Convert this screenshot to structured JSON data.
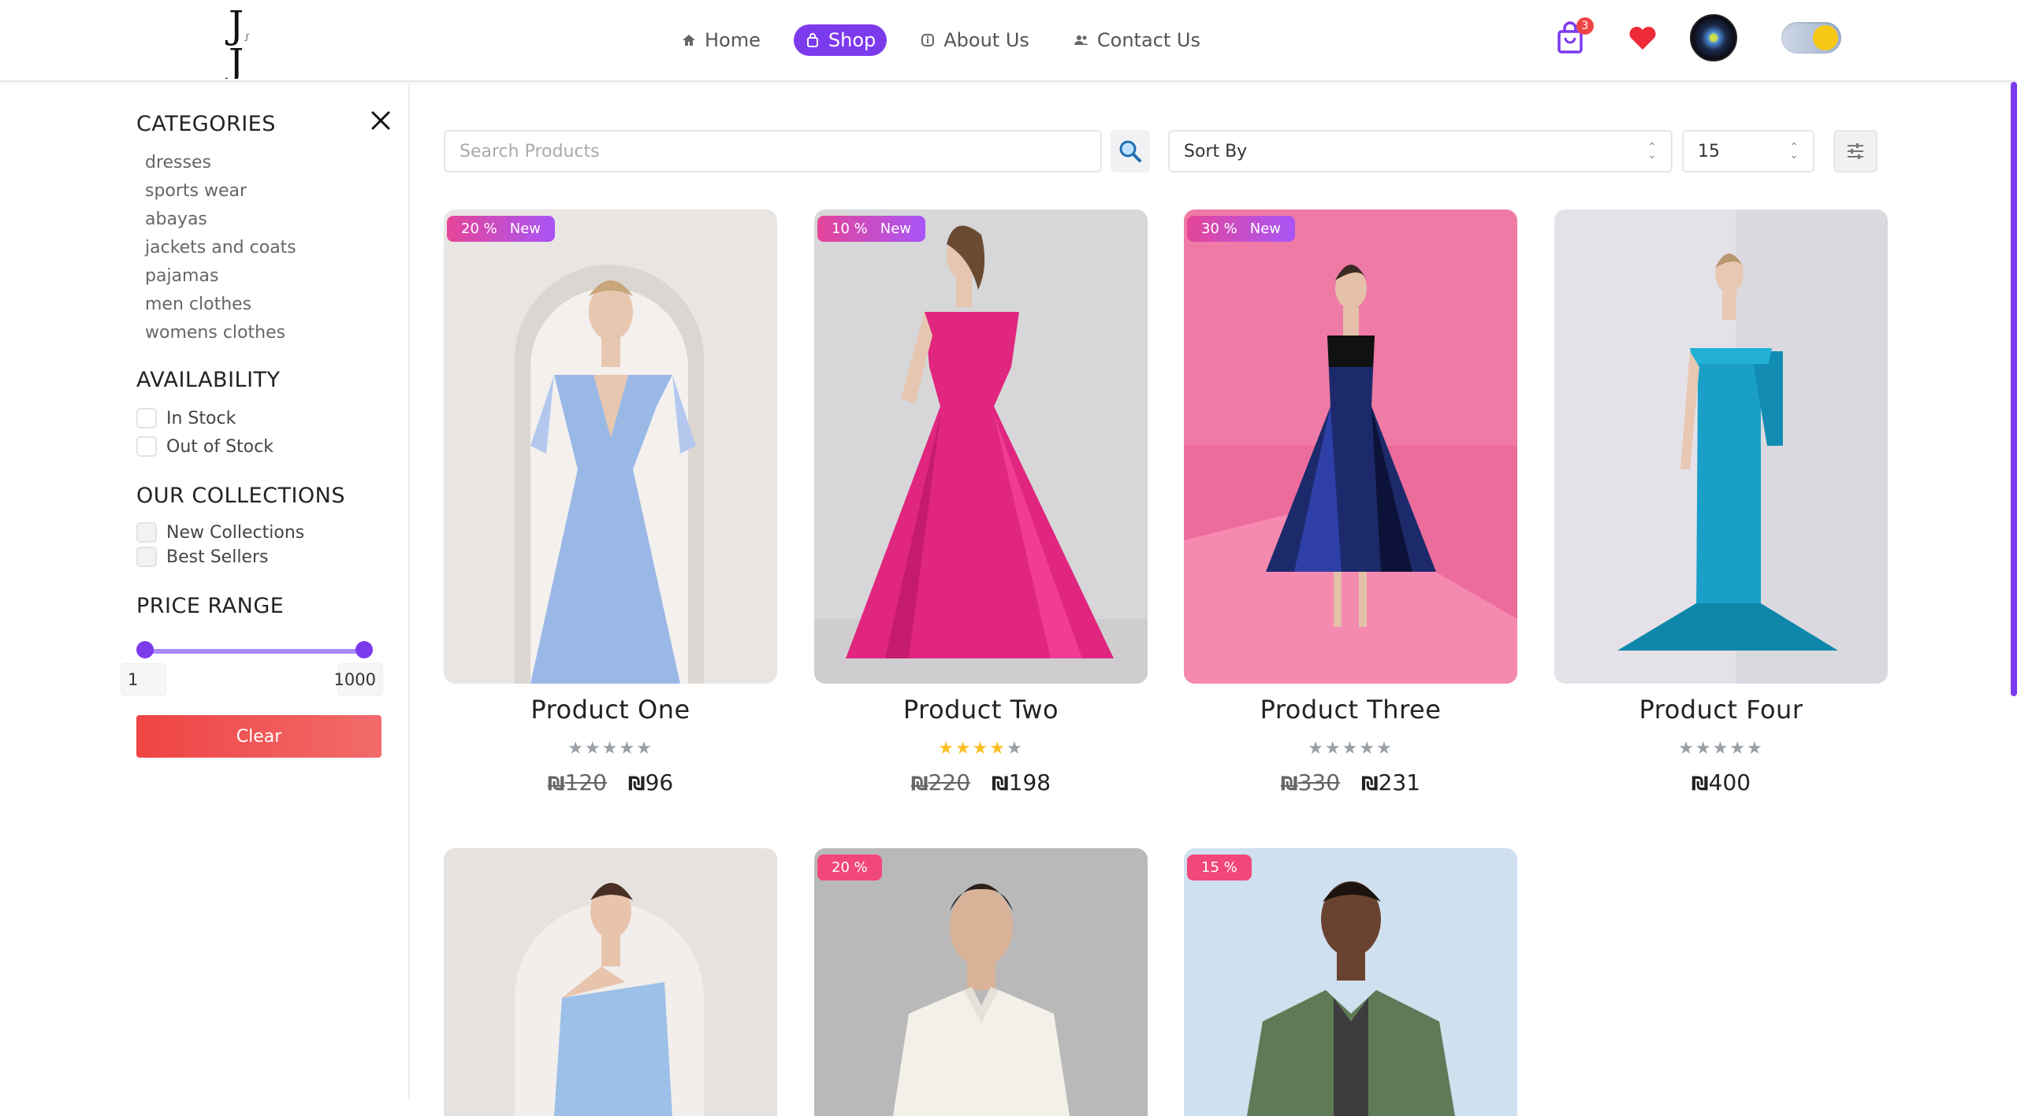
{
  "brand": {
    "logo_letter": "J"
  },
  "nav": [
    {
      "label": "Home",
      "icon": "home-icon"
    },
    {
      "label": "Shop",
      "icon": "shopping-bag-icon",
      "active": true
    },
    {
      "label": "About Us",
      "icon": "info-icon"
    },
    {
      "label": "Contact Us",
      "icon": "users-icon"
    }
  ],
  "cart": {
    "count": "3"
  },
  "colors": {
    "accent": "#7c3aed",
    "danger": "#ef4444",
    "badge_pink": "#e54598"
  },
  "sidebar": {
    "categories_title": "CATEGORIES",
    "categories": [
      "dresses",
      "sports wear",
      "abayas",
      "jackets and coats",
      "pajamas",
      "men clothes",
      "womens clothes"
    ],
    "availability_title": "AVAILABILITY",
    "availability": [
      "In Stock",
      "Out of Stock"
    ],
    "collections_title": "OUR COLLECTIONS",
    "collections": [
      "New Collections",
      "Best Sellers"
    ],
    "price_title": "PRICE RANGE",
    "price_min": "1",
    "price_max": "1000",
    "clear_label": "Clear"
  },
  "toolbar": {
    "search_placeholder": "Search Products",
    "sort_label": "Sort By",
    "per_page": "15"
  },
  "currency": "₪",
  "products": [
    {
      "name": "Product One",
      "discount": "20 %",
      "new_label": "New",
      "rating": 0,
      "old_price": "120",
      "price": "96"
    },
    {
      "name": "Product Two",
      "discount": "10 %",
      "new_label": "New",
      "rating": 4,
      "old_price": "220",
      "price": "198"
    },
    {
      "name": "Product Three",
      "discount": "30 %",
      "new_label": "New",
      "rating": 0,
      "old_price": "330",
      "price": "231"
    },
    {
      "name": "Product Four",
      "rating": 0,
      "price": "400"
    },
    {
      "name": ""
    },
    {
      "discount": "20 %"
    },
    {
      "discount": "15 %"
    }
  ]
}
